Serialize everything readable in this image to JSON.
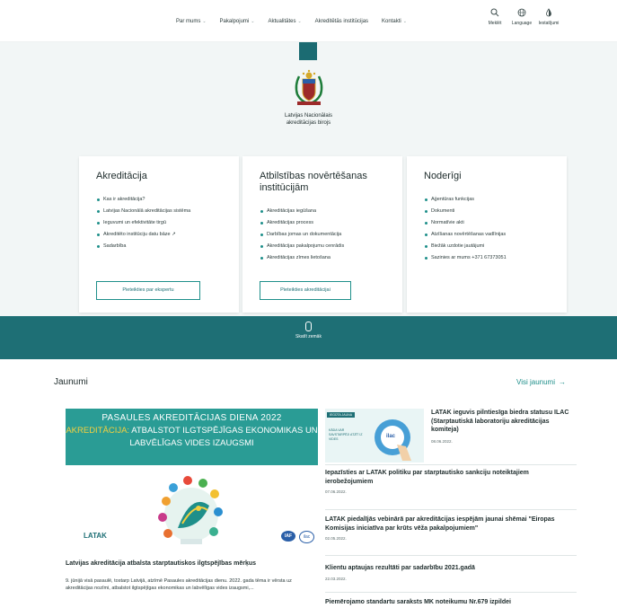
{
  "nav": {
    "menu": [
      "Par mums",
      "Pakalpojumi",
      "Aktualitātes",
      "Akreditētās institūcijas",
      "Kontakti"
    ],
    "menu_has_chevron": [
      true,
      true,
      true,
      false,
      true
    ],
    "tools": [
      {
        "label": "Meklēt",
        "icon": "search-icon"
      },
      {
        "label": "Language",
        "icon": "globe-icon"
      },
      {
        "label": "Iestatījumi",
        "icon": "contrast-icon"
      }
    ]
  },
  "hero": {
    "org_line1": "Latvijas Nacionālais",
    "org_line2": "akreditācijas birojs"
  },
  "cards": [
    {
      "title": "Akreditācija",
      "items": [
        "Kas ir akreditācija?",
        "Latvijas Nacionālā akreditācijas sistēma",
        "Ieguvumi un efektivitāte tirgū",
        "Akreditēto institūciju datu bāze ↗",
        "Sadarbība"
      ],
      "button": "Pieteikties par ekspertu"
    },
    {
      "title": "Atbilstības novērtēšanas institūcijām",
      "items": [
        "Akreditācijas iegūšana",
        "Akreditācijas process",
        "Darbības jomas un dokumentācija",
        "Akreditācijas pakalpojumu cenrādis",
        "Akreditācijas zīmes lietošana"
      ],
      "button": "Pieteikties akreditācijai"
    },
    {
      "title": "Noderīgi",
      "items": [
        "Aģentūras funkcijas",
        "Dokumenti",
        "Normatīvie akti",
        "Atzīšanas novērtēšanas vadlīnijas",
        "Biežāk uzdotie jautājumi",
        "Sazinies ar mums +371 67373051"
      ],
      "button": ""
    }
  ],
  "scroll_label": "Skatīt zemāk",
  "news": {
    "title": "Jaunumi",
    "all_label": "Visi jaunumi",
    "all_arrow": "→",
    "featured": {
      "banner_line1": "PASAULES AKREDITĀCIJAS DIENA 2022",
      "banner_line2_highlight": "AKREDITĀCIJA:",
      "banner_line2_rest": " ATBALSTOT ILGTSPĒJĪGAS EKONOMIKAS UN",
      "banner_line3": "LABVĒLĪGAS VIDES IZAUGSMI",
      "logo_left": "LATAK",
      "logo_iaf": "IAF",
      "logo_ilac": "ilac",
      "caption": "Latvijas akreditācija atbalsta starptautiskos ilgtspējības mērķus",
      "text": "9. jūnijā visā pasaulē, tostarp Latvijā, atzīmē Pasaules akreditācijas dienu. 2022. gada tēma ir vērsta uz akreditācijas nozīmi, atbalstot ilgtspējīgas ekonomikas un labvēlīgas vides izaugsmi,..."
    },
    "items": [
      {
        "title": "LATAK ieguvis pilntiesīga biedra statusu ILAC (Starptautiskā laboratoriju akreditācijas komiteja)",
        "date": "08.06.2022."
      },
      {
        "title": "Iepazīsties ar LATAK politiku par starptautisko sankciju noteiktajiem ierobežojumiem",
        "date": "07.06.2022."
      },
      {
        "title": "LATAK piedalījās vebinārā par akreditācijas iespējām jaunai shēmai \"Eiropas Komisijas iniciatīva par krūts vēža pakalpojumiem\"",
        "date": "02.05.2022."
      },
      {
        "title": "Klientu aptaujas rezultāti par sadarbību 2021.gadā",
        "date": "22.03.2022."
      },
      {
        "title": "Piemērojamo standartu saraksts MK noteikumu Nr.679 izpildei",
        "date": ""
      }
    ],
    "thumb_tag": "IEGŪTA JAUNA",
    "thumb_text": "KĀDA VAR SAVSTARPĒJI ATZĪT IZ VIDES",
    "thumb_logo": "ilac"
  },
  "colors": {
    "teal": "#1e6f75",
    "accent": "#1e8f8a",
    "highlight": "#f4d03f"
  }
}
